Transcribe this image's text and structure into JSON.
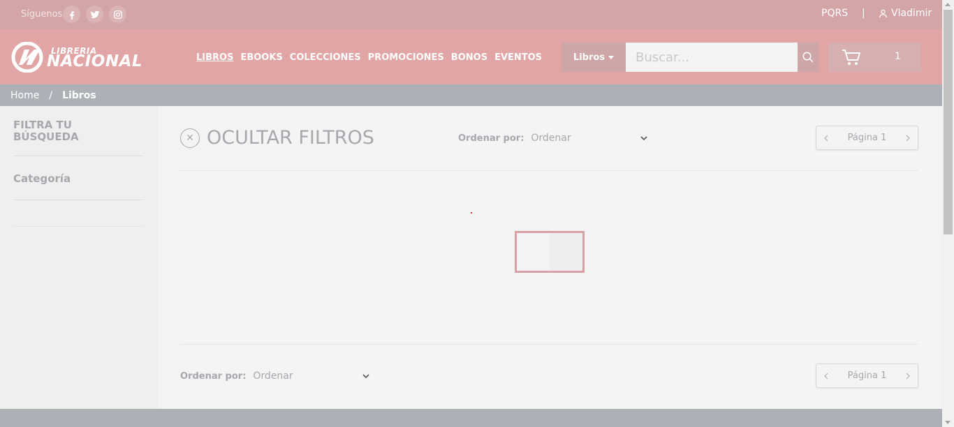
{
  "topbar": {
    "follow_label": "Síguenos",
    "social": [
      {
        "icon": "facebook-icon"
      },
      {
        "icon": "twitter-icon"
      },
      {
        "icon": "instagram-icon"
      }
    ],
    "pqrs": "PQRS",
    "separator": "|",
    "user_name": "Vladimir"
  },
  "header": {
    "logo": {
      "line1": "LIBRERIA",
      "line2": "NACIONAL"
    },
    "nav": [
      {
        "label": "LIBROS",
        "active": true
      },
      {
        "label": "EBOOKS",
        "active": false
      },
      {
        "label": "COLECCIONES",
        "active": false
      },
      {
        "label": "PROMOCIONES",
        "active": false
      },
      {
        "label": "BONOS",
        "active": false
      },
      {
        "label": "EVENTOS",
        "active": false
      }
    ],
    "search": {
      "category": "Libros",
      "placeholder": "Buscar...",
      "value": ""
    },
    "cart": {
      "count": "1"
    }
  },
  "breadcrumb": {
    "home": "Home",
    "separator": "/",
    "current": "Libros"
  },
  "sidebar": {
    "title": "FILTRA TU BÚSQUEDA",
    "category": "Categoría"
  },
  "main": {
    "hide_filters": "OCULTAR FILTROS",
    "order": {
      "label": "Ordenar por:",
      "selected": "Ordenar"
    },
    "pager": {
      "label": "Página 1"
    },
    "order_bottom": {
      "label": "Ordenar por:",
      "selected": "Ordenar"
    },
    "pager_bottom": {
      "label": "Página 1"
    }
  },
  "colors": {
    "topbar_bg": "#d4a5a7",
    "header_bg": "#e2a5a6",
    "breadcrumb_bg": "#aeb0b7",
    "text_muted": "#a6a8ae",
    "loader_border": "#d9a0a3"
  }
}
